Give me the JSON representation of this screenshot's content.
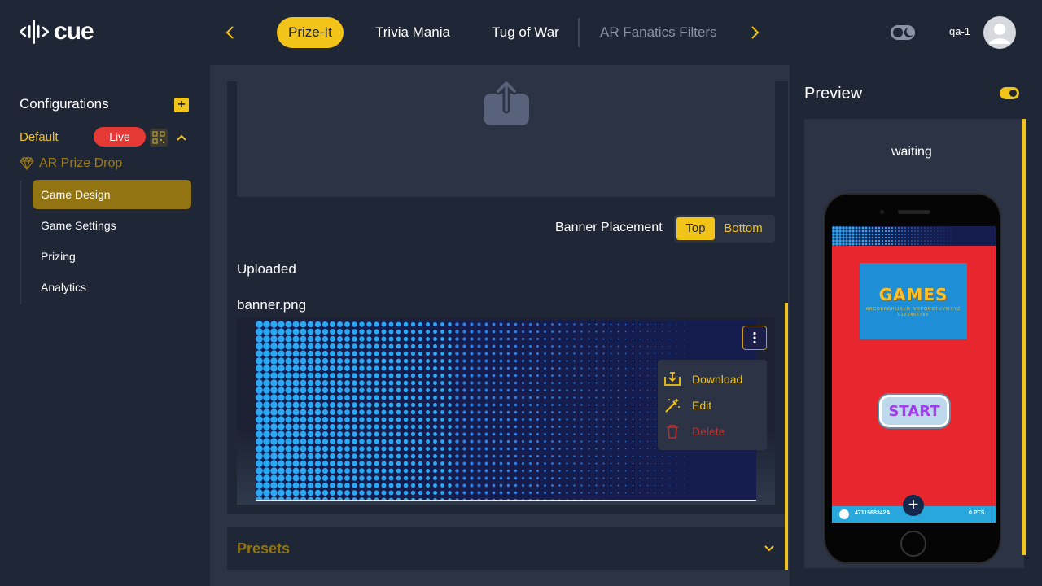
{
  "header": {
    "logo_text": "cue",
    "tabs": [
      {
        "label": "Prize-It",
        "state": "active"
      },
      {
        "label": "Trivia Mania",
        "state": "inactive"
      },
      {
        "label": "Tug of War",
        "state": "inactive"
      },
      {
        "label": "AR Fanatics Filters",
        "state": "dim"
      }
    ],
    "username": "qa-1",
    "icons": {
      "prev": "chevron-left-icon",
      "next": "chevron-right-icon",
      "theme": "theme-toggle-icon",
      "avatar": "user-avatar-icon"
    }
  },
  "sidebar": {
    "title": "Configurations",
    "add_label": "+",
    "config_name": "Default",
    "live_badge": "Live",
    "game_name": "AR Prize Drop",
    "items": [
      {
        "label": "Game Design",
        "active": true
      },
      {
        "label": "Game Settings",
        "active": false
      },
      {
        "label": "Prizing",
        "active": false
      },
      {
        "label": "Analytics",
        "active": false
      }
    ]
  },
  "main": {
    "banner_placement": {
      "label": "Banner Placement",
      "options": [
        "Top",
        "Bottom"
      ],
      "selected": "Top"
    },
    "uploaded_label": "Uploaded",
    "file_name": "banner.png",
    "context_menu": {
      "download": "Download",
      "edit": "Edit",
      "delete": "Delete"
    },
    "presets_label": "Presets"
  },
  "preview": {
    "title": "Preview",
    "status": "waiting",
    "phone": {
      "logo_title": "GAMES",
      "logo_sub": "ABCDEFGHIJKLM NOPQRSTUVWXYZ 0123456789",
      "start_label": "START",
      "code": "4711568342A",
      "points": "0 PTS."
    }
  },
  "colors": {
    "accent": "#f2c318",
    "background": "#1f2636",
    "panel": "#2b3345",
    "live": "#e53935",
    "delete": "#b83232"
  }
}
